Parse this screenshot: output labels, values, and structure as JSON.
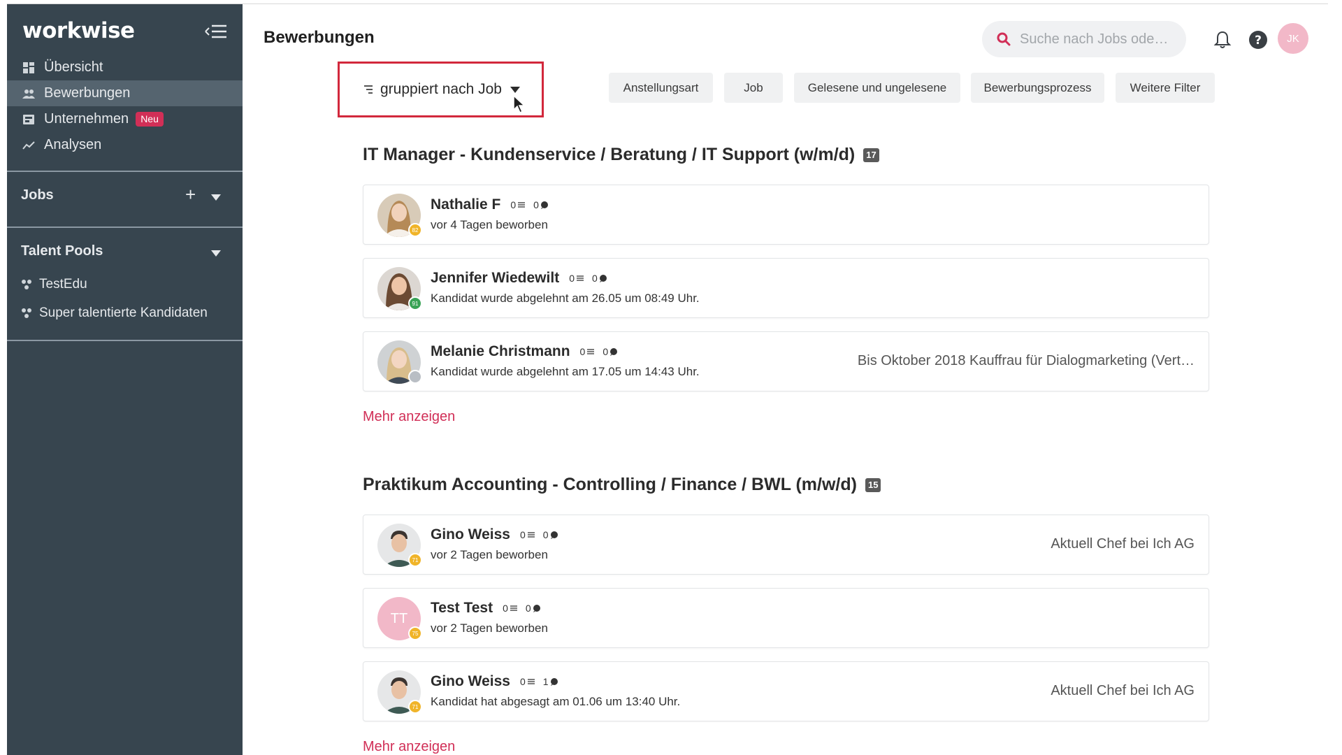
{
  "app": {
    "logo": "workwise"
  },
  "sidebar": {
    "nav": [
      {
        "label": "Übersicht",
        "icon": "grid-icon"
      },
      {
        "label": "Bewerbungen",
        "icon": "people-icon"
      },
      {
        "label": "Unternehmen",
        "icon": "company-icon",
        "badge": "Neu"
      },
      {
        "label": "Analysen",
        "icon": "chart-icon"
      }
    ],
    "jobs_title": "Jobs",
    "jobs_add": "+",
    "talent_pools_title": "Talent Pools",
    "talent_pools": [
      {
        "label": "TestEdu"
      },
      {
        "label": "Super talentierte Kandidaten"
      }
    ]
  },
  "header": {
    "title": "Bewerbungen",
    "search_placeholder": "Suche nach Jobs ode…",
    "avatar_initials": "JK"
  },
  "toolbar": {
    "group_by": "gruppiert nach Job",
    "filters": [
      "Anstellungsart",
      "Job",
      "Gelesene und ungelesene",
      "Bewerbungsprozess",
      "Weitere Filter"
    ]
  },
  "groups": [
    {
      "title": "IT Manager - Kundenservice / Beratung / IT Support (w/m/d)",
      "count": "17",
      "candidates": [
        {
          "name": "Nathalie F",
          "notes": "0",
          "comments": "0",
          "status": "vor 4 Tagen beworben",
          "right": "",
          "score": "82",
          "score_color": "#f0b429",
          "avatar": "photo-f1"
        },
        {
          "name": "Jennifer Wiedewilt",
          "notes": "0",
          "comments": "0",
          "status": "Kandidat wurde abgelehnt am 26.05 um 08:49 Uhr.",
          "right": "",
          "score": "91",
          "score_color": "#3aa356",
          "avatar": "photo-f2"
        },
        {
          "name": "Melanie Christmann",
          "notes": "0",
          "comments": "0",
          "status": "Kandidat wurde abgelehnt am 17.05 um 14:43 Uhr.",
          "right": "Bis Oktober 2018 Kauffrau für Dialogmarketing (Vert…",
          "score": "",
          "score_color": "#b9bec4",
          "avatar": "photo-f3"
        }
      ],
      "more": "Mehr anzeigen"
    },
    {
      "title": "Praktikum Accounting - Controlling / Finance / BWL (m/w/d)",
      "count": "15",
      "candidates": [
        {
          "name": "Gino Weiss",
          "notes": "0",
          "comments": "0",
          "status": "vor 2 Tagen beworben",
          "right": "Aktuell Chef bei Ich AG",
          "score": "71",
          "score_color": "#f0b429",
          "avatar": "photo-m1"
        },
        {
          "name": "Test Test",
          "notes": "0",
          "comments": "0",
          "status": "vor 2 Tagen beworben",
          "right": "",
          "score": "75",
          "score_color": "#f0b429",
          "avatar": "initials",
          "initials": "TT"
        },
        {
          "name": "Gino Weiss",
          "notes": "0",
          "comments": "1",
          "status": "Kandidat hat abgesagt am 01.06 um 13:40 Uhr.",
          "right": "Aktuell Chef bei Ich AG",
          "score": "71",
          "score_color": "#f0b429",
          "avatar": "photo-m1"
        }
      ],
      "more": "Mehr anzeigen"
    }
  ],
  "colors": {
    "sidebar_bg": "#37454f",
    "sidebar_active": "#55646f",
    "accent": "#d12f57",
    "highlight_box": "#d2283c"
  }
}
